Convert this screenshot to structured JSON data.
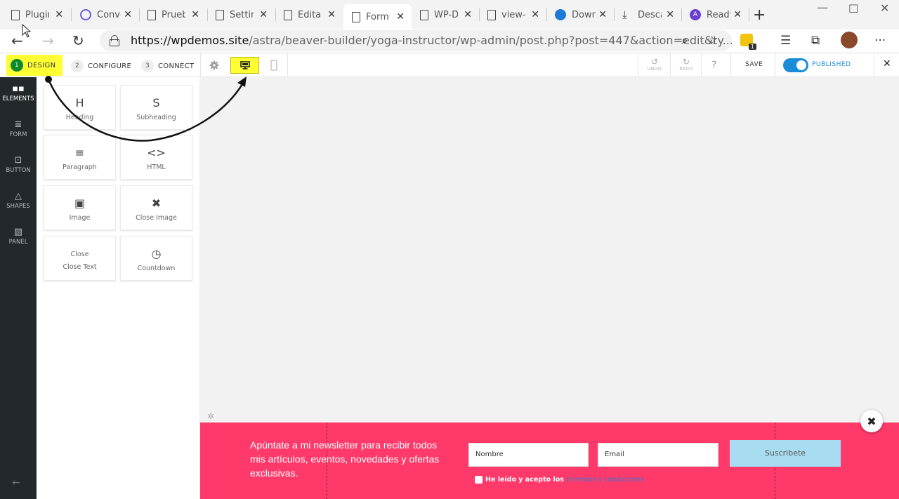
{
  "browser": {
    "tabs": [
      {
        "title": "Plugir",
        "icon": "page"
      },
      {
        "title": "Conve",
        "icon": "compass"
      },
      {
        "title": "Prueb",
        "icon": "page"
      },
      {
        "title": "Settin",
        "icon": "page"
      },
      {
        "title": "Editar",
        "icon": "page"
      },
      {
        "title": "Formu",
        "icon": "page",
        "active": true
      },
      {
        "title": "WP-D",
        "icon": "page"
      },
      {
        "title": "view-",
        "icon": "page"
      },
      {
        "title": "Down",
        "icon": "wifi"
      },
      {
        "title": "Desca",
        "icon": "download"
      },
      {
        "title": "Ready",
        "icon": "astra"
      }
    ],
    "url_host": "https://wpdemos.site",
    "url_path": "/astra/beaver-builder/yoga-instructor/wp-admin/post.php?post=447&action=edit&ty...",
    "extension_badge": "1"
  },
  "builder": {
    "steps": [
      {
        "num": "1",
        "label": "DESIGN",
        "active": true
      },
      {
        "num": "2",
        "label": "CONFIGURE"
      },
      {
        "num": "3",
        "label": "CONNECT"
      }
    ],
    "undo": "UNDO",
    "redo": "REDO",
    "help": "?",
    "save": "SAVE",
    "published": "PUBLISHED",
    "accent_color": "#1a8cd8",
    "highlight_color": "#ffff33"
  },
  "sidebar": {
    "items": [
      {
        "label": "ELEMENTS",
        "icon": "grid-icon",
        "active": true
      },
      {
        "label": "FORM",
        "icon": "form-icon"
      },
      {
        "label": "BUTTON",
        "icon": "button-icon"
      },
      {
        "label": "SHAPES",
        "icon": "shapes-icon"
      },
      {
        "label": "PANEL",
        "icon": "panel-icon"
      }
    ]
  },
  "elements": {
    "cards": [
      {
        "glyph": "H",
        "label": "Heading"
      },
      {
        "glyph": "S",
        "label": "Subheading"
      },
      {
        "glyph": "≡",
        "label": "Paragraph"
      },
      {
        "glyph": "<>",
        "label": "HTML"
      },
      {
        "glyph": "▣",
        "label": "Image"
      },
      {
        "glyph": "✖",
        "label": "Close Image"
      },
      {
        "line1": "Close",
        "line2": "Close Text"
      },
      {
        "glyph": "◷",
        "label": "Countdown"
      }
    ]
  },
  "banner": {
    "text": "Apúntate a mi newsletter para recibir todos mis artículos, eventos, novedades y ofertas exclusivas.",
    "name_placeholder": "Nombre",
    "email_placeholder": "Email",
    "button_label": "Suscribete",
    "consent_text": "He leído y acepto los",
    "consent_link": "terminos y condiciones",
    "background_color": "#ff3a6a",
    "button_color": "#a8dcf0"
  }
}
